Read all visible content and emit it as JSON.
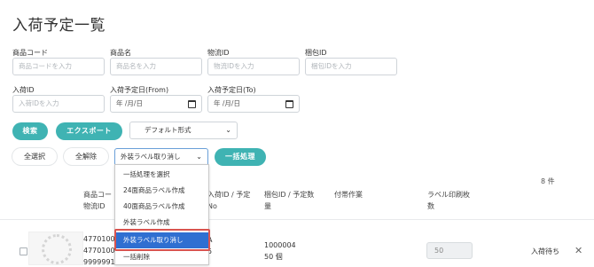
{
  "page": {
    "title": "入荷予定一覧"
  },
  "search": {
    "product_code": {
      "label": "商品コード",
      "placeholder": "商品コードを入力"
    },
    "product_name": {
      "label": "商品名",
      "placeholder": "商品名を入力"
    },
    "logistics_id": {
      "label": "物流ID",
      "placeholder": "物流IDを入力"
    },
    "package_id": {
      "label": "梱包ID",
      "placeholder": "梱包IDを入力"
    },
    "arrival_id": {
      "label": "入荷ID",
      "placeholder": "入荷IDを入力"
    },
    "date_from": {
      "label": "入荷予定日(From)",
      "value": "年 /月/日"
    },
    "date_to": {
      "label": "入荷予定日(To)",
      "value": "年 /月/日"
    }
  },
  "actions": {
    "search_label": "検索",
    "export_label": "エクスポート",
    "format_select": "デフォルト形式",
    "select_all": "全選択",
    "deselect_all": "全解除",
    "bulk_select_value": "外装ラベル取り消し",
    "bulk_process": "一括処理"
  },
  "dropdown": {
    "options": [
      {
        "label": "一括処理を選択",
        "selected": false
      },
      {
        "label": "24面商品ラベル作成",
        "selected": false
      },
      {
        "label": "40面商品ラベル作成",
        "selected": false
      },
      {
        "label": "外装ラベル作成",
        "selected": false
      },
      {
        "label": "外装ラベル取り消し",
        "selected": true
      },
      {
        "label": "一括削除",
        "selected": false
      }
    ]
  },
  "table": {
    "count": "8 件",
    "headers": {
      "product": [
        "商品コー",
        "物流ID"
      ],
      "arrival": [
        "入荷ID / 予定",
        "No"
      ],
      "package": [
        "梱包ID / 予定数",
        "量"
      ],
      "note": "付帯作業",
      "label_count": [
        "ラベル印刷枚",
        "数"
      ]
    },
    "rows": [
      {
        "codes": [
          "4770100",
          "4770100",
          "9999991"
        ],
        "arrival": [
          "A",
          "5"
        ],
        "package_id": "1000004",
        "quantity": "50 個",
        "label_count": "50",
        "status": "入荷待ち"
      }
    ]
  },
  "colors": {
    "accent": "#3fb3b3",
    "selected": "#2f6fd1",
    "highlight": "#d9534f"
  }
}
